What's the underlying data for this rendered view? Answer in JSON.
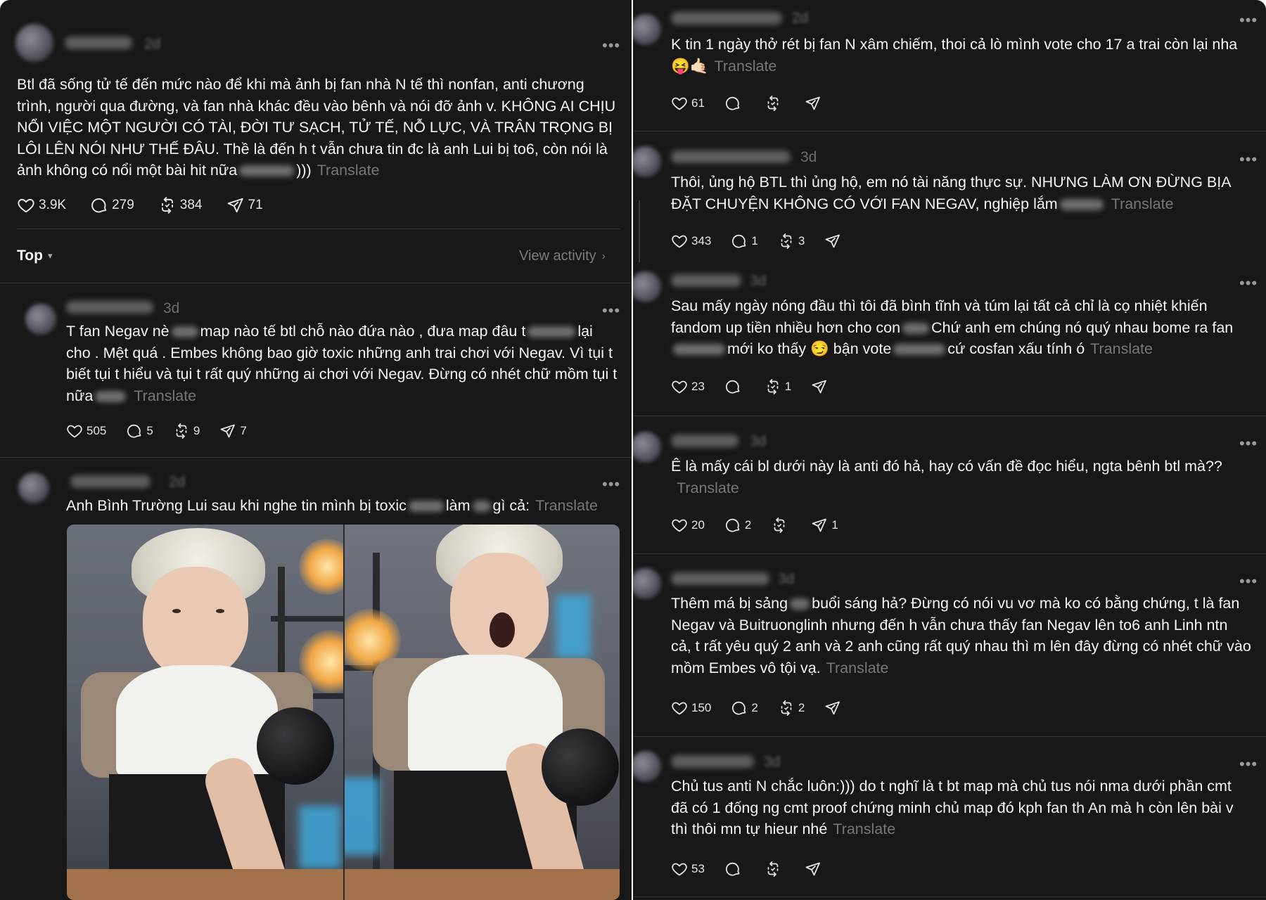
{
  "main_post": {
    "time": "2d",
    "text": "Btl đã sống tử tế đến mức nào để khi mà ảnh bị fan nhà N tế thì nonfan, anti chương trình, người qua đường, và fan nhà khác đều vào bênh và nói đỡ ảnh v. KHÔNG AI CHỊU NỔI VIỆC MỘT NGƯỜI CÓ TÀI, ĐỜI TƯ SẠCH, TỬ TẾ, NỖ LỰC, VÀ TRÂN TRỌNG BỊ LÔI LÊN NÓI NHƯ THẾ ĐÂU. Thề là đến h t vẫn chưa tin đc là anh Lui bị to6, còn nói là ảnh không có nổi một bài hit nữa",
    "text_tail": ")))",
    "translate": "Translate",
    "likes": "3.9K",
    "replies": "279",
    "reposts": "384",
    "shares": "71"
  },
  "replies_header": {
    "sort": "Top",
    "view_activity": "View activity"
  },
  "left_comments": [
    {
      "time": "3d",
      "text_a": "T fan Negav nè",
      "text_b": "map nào tế btl chỗ nào đứa nào , đưa map đâu t",
      "text_c": "lại cho . Mệt quá . Embes không bao giờ toxic những anh trai chơi với Negav. Vì tụi t biết tụi t hiểu và tụi t rất quý những ai chơi với Negav. Đừng có nhét chữ mồm tụi t nữa",
      "translate": "Translate",
      "likes": "505",
      "replies": "5",
      "reposts": "9",
      "shares": "7"
    },
    {
      "time": "2d",
      "text_a": "Anh Bình Trường Lui sau khi nghe tin mình bị toxic",
      "text_b": "làm",
      "text_c": "gì cả:",
      "translate": "Translate"
    }
  ],
  "right_comments": [
    {
      "time": "2d",
      "text": "K tin 1 ngày thở rét bị fan N xâm chiếm, thoi cả lò mình vote cho 17 a trai còn lại nha 😝🤙🏻",
      "translate": "Translate",
      "likes": "61",
      "replies": "",
      "reposts": ""
    },
    {
      "time": "3d",
      "text": "Thôi, ủng hộ BTL thì ủng hộ, em nó tài năng thực sự. NHƯNG LÀM ƠN ĐỪNG BỊA ĐẶT CHUYỆN KHÔNG CÓ VỚI FAN NEGAV, nghiệp lắm",
      "translate": "Translate",
      "likes": "343",
      "replies": "1",
      "reposts": "3"
    },
    {
      "time": "3d",
      "text_a": "Sau mấy ngày nóng đầu thì tôi đã bình tĩnh và túm lại tất cả chỉ là cọ nhiệt khiến fandom up tiền nhiều hơn cho con",
      "text_b": "Chứ anh em chúng nó quý nhau bome ra fan",
      "text_c": "mới ko thấy 😏 bận vote",
      "text_d": "cứ cosfan xấu tính ó",
      "translate": "Translate",
      "likes": "23",
      "replies": "",
      "reposts": "1"
    },
    {
      "time": "3d",
      "text": "Ê là mấy cái bl dưới này là anti đó hả, hay có vấn đề đọc hiểu, ngta bênh btl mà??",
      "translate": "Translate",
      "likes": "20",
      "replies": "2",
      "reposts": "",
      "shares": "1"
    },
    {
      "time": "3d",
      "text_a": "Thêm má bị sảng",
      "text_b": "buổi sáng hả? Đừng có nói vu vơ mà ko có bằng chứng, t là fan Negav và Buitruonglinh nhưng đến h vẫn chưa thấy fan Negav lên to6 anh Linh ntn cả, t rất yêu quý 2 anh và 2 anh cũng rất quý nhau thì m lên đây đừng có nhét chữ vào mồm Embes vô tội vạ.",
      "translate": "Translate",
      "likes": "150",
      "replies": "2",
      "reposts": "2"
    },
    {
      "time": "3d",
      "text": "Chủ tus anti N chắc luôn:))) do t nghĩ là t bt map mà chủ tus nói nma dưới phần cmt đã có 1 đống ng cmt proof chứng minh chủ map đó kph fan th An mà h còn lên bài v thì thôi mn tự hieur nhé",
      "translate": "Translate",
      "likes": "53",
      "replies": "",
      "reposts": ""
    }
  ],
  "icons": {
    "like": "heart-icon",
    "reply": "comment-icon",
    "repost": "repost-icon",
    "share": "send-icon",
    "more": "more-horizontal-icon"
  },
  "colors": {
    "background": "#181818",
    "text": "#f3f5f7",
    "muted": "#777777",
    "divider": "#343434"
  }
}
